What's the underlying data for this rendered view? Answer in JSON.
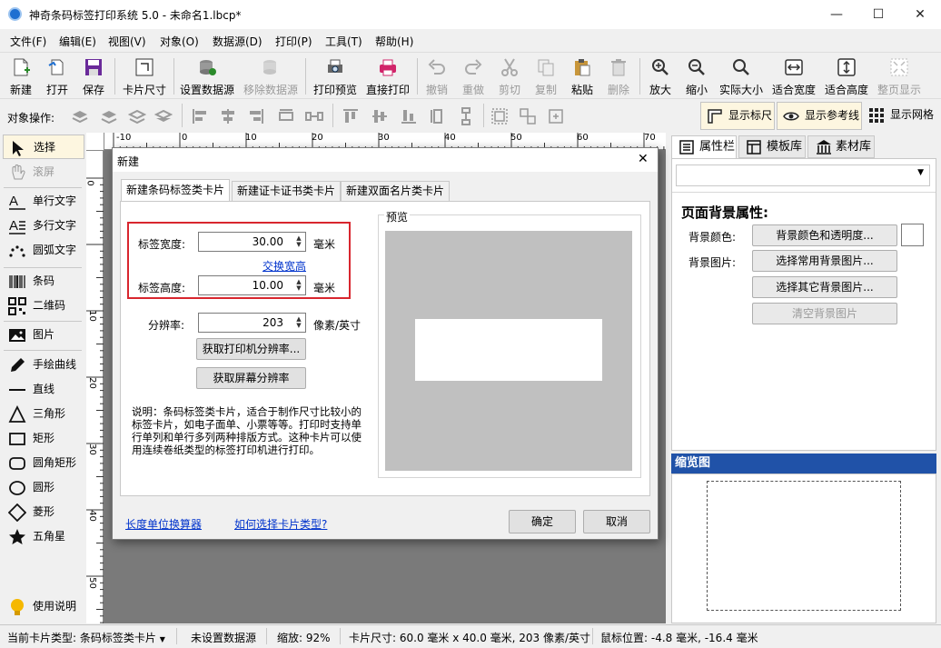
{
  "window": {
    "title": "神奇条码标签打印系统 5.0 - 未命名1.lbcp*",
    "minimize": "—",
    "maximize": "☐",
    "close": "✕"
  },
  "menu": [
    "文件(F)",
    "编辑(E)",
    "视图(V)",
    "对象(O)",
    "数据源(D)",
    "打印(P)",
    "工具(T)",
    "帮助(H)"
  ],
  "toolbar": {
    "new": "新建",
    "open": "打开",
    "save": "保存",
    "card_size": "卡片尺寸",
    "set_datasource": "设置数据源",
    "remove_datasource": "移除数据源",
    "print_preview": "打印预览",
    "direct_print": "直接打印",
    "undo": "撤销",
    "redo": "重做",
    "cut": "剪切",
    "copy": "复制",
    "paste": "粘贴",
    "delete": "删除",
    "zoom_in": "放大",
    "zoom_out": "缩小",
    "actual_size": "实际大小",
    "fit_width": "适合宽度",
    "fit_height": "适合高度",
    "fit_page": "整页显示"
  },
  "objbar": {
    "label": "对象操作:",
    "show_ruler": "显示标尺",
    "show_guides": "显示参考线",
    "show_grid": "显示网格"
  },
  "tools": {
    "select": "选择",
    "scroll": "滚屏",
    "single_text": "单行文字",
    "multi_text": "多行文字",
    "arc_text": "圆弧文字",
    "barcode": "条码",
    "qrcode": "二维码",
    "image": "图片",
    "freehand": "手绘曲线",
    "line": "直线",
    "triangle": "三角形",
    "rect": "矩形",
    "round_rect": "圆角矩形",
    "circle": "圆形",
    "diamond": "菱形",
    "star": "五角星",
    "help": "使用说明"
  },
  "ruler": {
    "h": [
      "-10",
      "0",
      "10",
      "20",
      "30",
      "40",
      "50",
      "60",
      "70"
    ],
    "v": [
      "0",
      "10",
      "20",
      "30",
      "40",
      "50"
    ]
  },
  "rpanel": {
    "tab_props": "属性栏",
    "tab_templates": "模板库",
    "tab_assets": "素材库",
    "section_title": "页面背景属性:",
    "bg_color_label": "背景颜色:",
    "bg_color_btn": "背景颜色和透明度...",
    "bg_image_label": "背景图片:",
    "bg_common_btn": "选择常用背景图片...",
    "bg_other_btn": "选择其它背景图片...",
    "bg_clear_btn": "清空背景图片",
    "thumbnail_title": "缩览图"
  },
  "status": {
    "card_type": "当前卡片类型: 条码标签类卡片",
    "datasource": "未设置数据源",
    "zoom": "缩放: 92%",
    "card_size": "卡片尺寸: 60.0 毫米 x 40.0 毫米, 203 像素/英寸",
    "mouse_pos": "鼠标位置: -4.8 毫米, -16.4 毫米"
  },
  "dialog": {
    "title": "新建",
    "close": "✕",
    "tabs": [
      "新建条码标签类卡片",
      "新建证卡证书类卡片",
      "新建双面名片类卡片"
    ],
    "width_label": "标签宽度:",
    "width_value": "30.00",
    "width_unit": "毫米",
    "swap_link": "交换宽高",
    "height_label": "标签高度:",
    "height_value": "10.00",
    "height_unit": "毫米",
    "dpi_label": "分辨率:",
    "dpi_value": "203",
    "dpi_unit": "像素/英寸",
    "get_printer_dpi": "获取打印机分辨率...",
    "get_screen_dpi": "获取屏幕分辨率",
    "preview_label": "预览",
    "description": "说明：条码标签类卡片，适合于制作尺寸比较小的标签卡片，如电子面单、小票等等。打印时支持单行单列和单行多列两种排版方式。这种卡片可以使用连续卷纸类型的标签打印机进行打印。",
    "unit_calc_link": "长度单位换算器",
    "choose_type_link": "如何选择卡片类型?",
    "ok": "确定",
    "cancel": "取消"
  }
}
